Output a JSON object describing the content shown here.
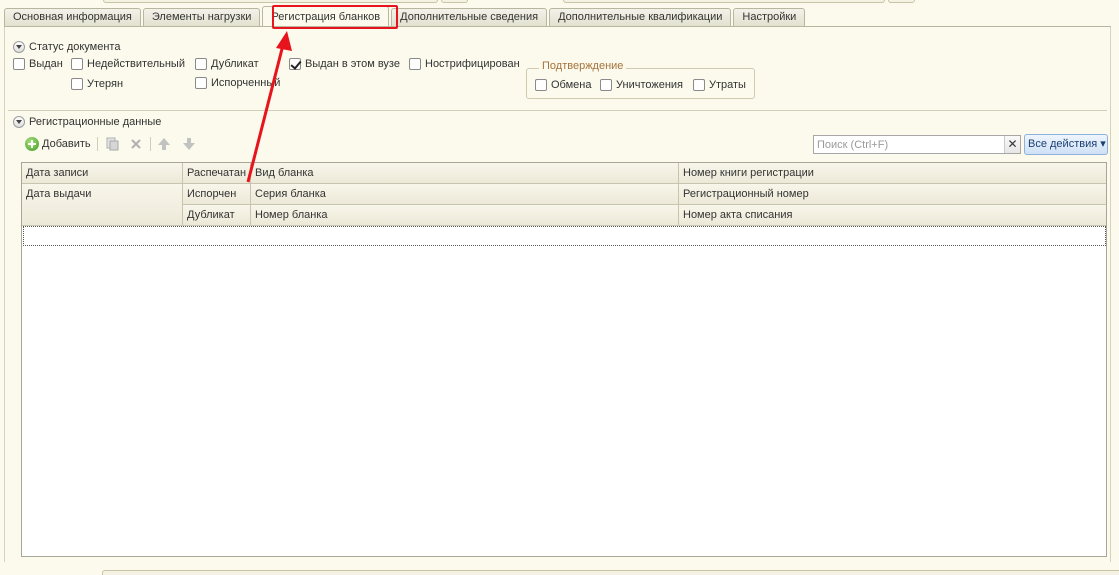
{
  "tabs": [
    {
      "label": "Основная информация",
      "active": false
    },
    {
      "label": "Элементы нагрузки",
      "active": false
    },
    {
      "label": "Регистрация бланков",
      "active": true
    },
    {
      "label": "Дополнительные сведения",
      "active": false
    },
    {
      "label": "Дополнительные квалификации",
      "active": false
    },
    {
      "label": "Настройки",
      "active": false
    }
  ],
  "status_group": {
    "title": "Статус документа",
    "checkboxes": {
      "issued": {
        "label": "Выдан",
        "checked": false
      },
      "invalid": {
        "label": "Недействительный",
        "checked": false
      },
      "duplicate": {
        "label": "Дубликат",
        "checked": false
      },
      "issued_in_university": {
        "label": "Выдан в этом вузе",
        "checked": true
      },
      "nostrified": {
        "label": "Нострифицирован",
        "checked": false
      },
      "lost": {
        "label": "Утерян",
        "checked": false
      },
      "damaged": {
        "label": "Испорченный",
        "checked": false
      }
    },
    "confirmation": {
      "title": "Подтверждение",
      "exchange": {
        "label": "Обмена",
        "checked": false
      },
      "destruction": {
        "label": "Уничтожения",
        "checked": false
      },
      "loss": {
        "label": "Утраты",
        "checked": false
      }
    }
  },
  "registration_group": {
    "title": "Регистрационные данные",
    "toolbar": {
      "add_label": "Добавить",
      "search_placeholder": "Поиск (Ctrl+F)",
      "clear_glyph": "✕",
      "all_actions_label": "Все действия ▾"
    },
    "table": {
      "headers": {
        "record_date": "Дата записи",
        "issue_date": "Дата выдачи",
        "printed": "Распечатан",
        "spoiled": "Испорчен",
        "duplicate": "Дубликат",
        "form_type": "Вид бланка",
        "form_series": "Серия бланка",
        "form_number": "Номер бланка",
        "book_number": "Номер книги регистрации",
        "reg_number": "Регистрационный номер",
        "writeoff_act": "Номер акта списания"
      },
      "rows": []
    }
  },
  "annotation": {
    "color": "#e8141d"
  }
}
